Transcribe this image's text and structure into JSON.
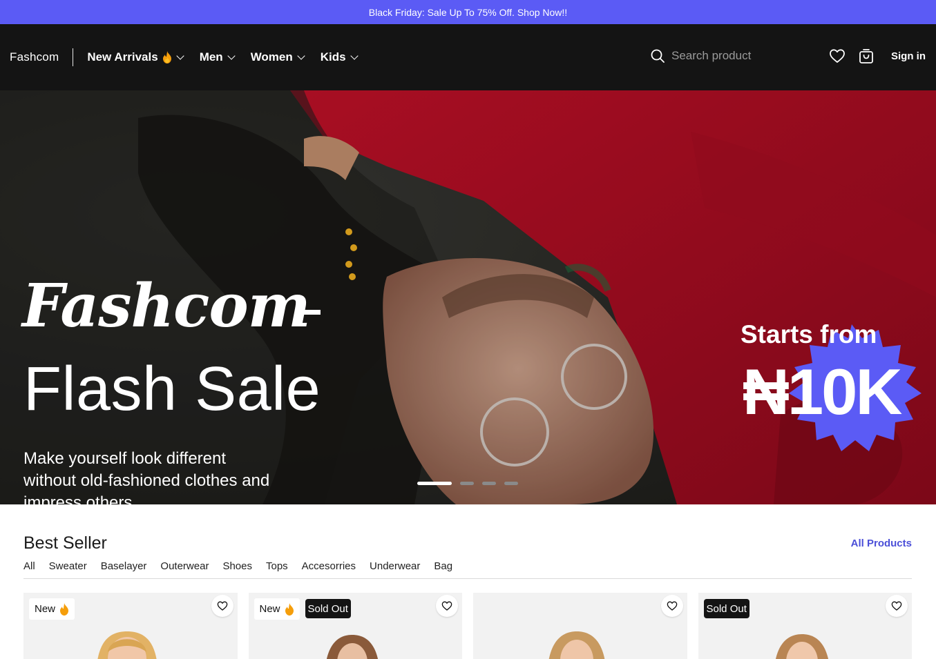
{
  "promo": {
    "text": "Black Friday: Sale Up To 75% Off. Shop Now!!"
  },
  "header": {
    "brand": "Fashcom",
    "menu": [
      {
        "label": "New Arrivals",
        "icon": "flame-icon"
      },
      {
        "label": "Men"
      },
      {
        "label": "Women"
      },
      {
        "label": "Kids"
      }
    ],
    "search_placeholder": "Search product",
    "signin_label": "Sign in"
  },
  "hero": {
    "title": "Fashcom",
    "subtitle": "Flash Sale",
    "description": "Make yourself look different without old-fashioned clothes and impress others",
    "starts_label": "Starts from",
    "price": "₦10K",
    "slides_total": 4,
    "active_slide": 1,
    "accent_color": "#5b5bf5"
  },
  "bestseller": {
    "title": "Best Seller",
    "all_products_label": "All Products",
    "filters": [
      "All",
      "Sweater",
      "Baselayer",
      "Outerwear",
      "Shoes",
      "Tops",
      "Accesorries",
      "Underwear",
      "Bag"
    ],
    "cards": [
      {
        "new_label": "New",
        "sold_label": ""
      },
      {
        "new_label": "New",
        "sold_label": "Sold Out"
      },
      {
        "new_label": "",
        "sold_label": ""
      },
      {
        "new_label": "",
        "sold_label": "Sold Out"
      }
    ]
  },
  "colors": {
    "promo_bg": "#5b5bf5",
    "nav_bg": "#141414",
    "link": "#4b4fd8",
    "flame": "#f59e0b"
  }
}
